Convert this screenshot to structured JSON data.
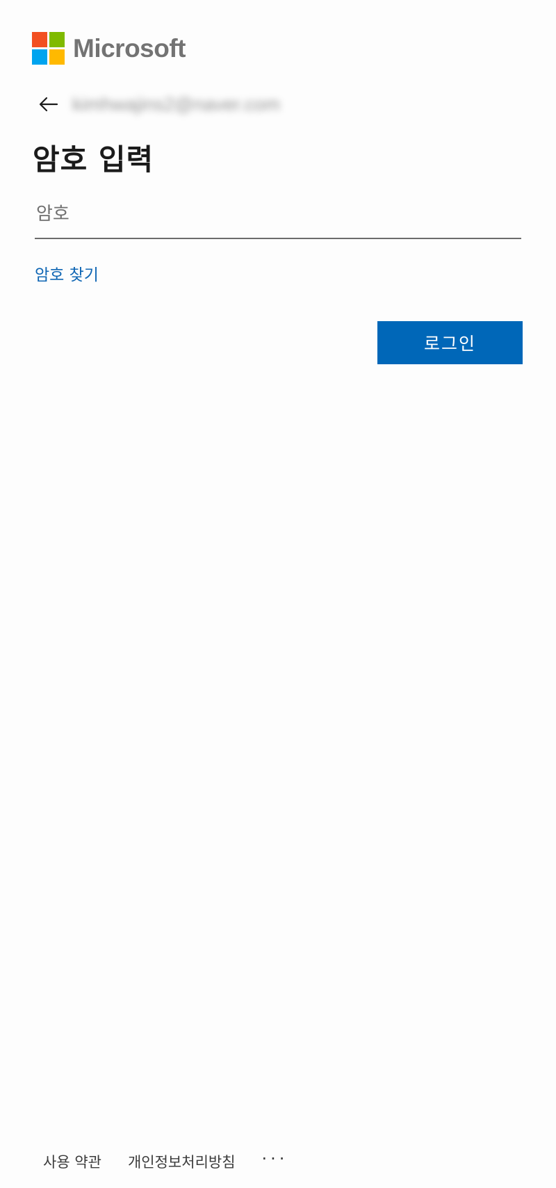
{
  "brand": {
    "name": "Microsoft",
    "logo_colors": [
      "#f25022",
      "#7fba00",
      "#00a4ef",
      "#ffb900"
    ]
  },
  "identity": {
    "back_icon": "arrow-left-icon",
    "email": "kimhwajins2@naver.com"
  },
  "title": "암호 입력",
  "password": {
    "value": "",
    "placeholder": "암호"
  },
  "forgot_link": "암호 찾기",
  "signin_label": "로그인",
  "colors": {
    "primary": "#0067b8",
    "link": "#0f66b4"
  },
  "footer": {
    "terms": "사용 약관",
    "privacy": "개인정보처리방침",
    "more": "···"
  }
}
